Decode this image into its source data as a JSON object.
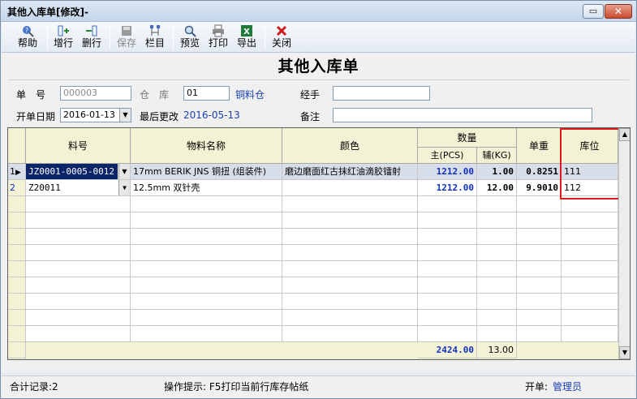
{
  "window": {
    "title": "其他入库单[修改]-",
    "restore_glyph": "▭",
    "close_glyph": "✕"
  },
  "toolbar": {
    "items": [
      {
        "label": "帮助",
        "icon": "help-icon"
      },
      {
        "label": "增行",
        "icon": "add-row-icon"
      },
      {
        "label": "删行",
        "icon": "delete-row-icon"
      },
      {
        "label": "保存",
        "icon": "save-icon"
      },
      {
        "label": "栏目",
        "icon": "columns-icon"
      },
      {
        "label": "预览",
        "icon": "preview-icon"
      },
      {
        "label": "打印",
        "icon": "print-icon"
      },
      {
        "label": "导出",
        "icon": "excel-export-icon"
      },
      {
        "label": "关闭",
        "icon": "close-icon"
      }
    ]
  },
  "form": {
    "doc_title": "其他入库单",
    "doc_no_label": "单　号",
    "doc_no_value": "000003",
    "warehouse_label": "仓　库",
    "warehouse_code": "01",
    "warehouse_name": "铜料仓",
    "handler_label": "经手",
    "handler_value": "",
    "date_label": "开单日期",
    "date_value": "2016-01-13",
    "modified_label": "最后更改",
    "modified_value": "2016-05-13",
    "remark_label": "备注",
    "remark_value": ""
  },
  "grid": {
    "headers": {
      "item_no": "料号",
      "item_name": "物料名称",
      "color": "颜色",
      "qty": "数量",
      "main_unit": "主(PCS)",
      "aux_unit": "辅(KG)",
      "unit_weight": "单重",
      "location": "库位"
    },
    "rows": [
      {
        "index": "1",
        "item_no": "JZ0001-0005-0012",
        "item_name": "17mm BERIK JNS 铜扭 (组装件)",
        "color": "磨边磨面红古抹红油滴胶镭射",
        "main_qty": "1212.00",
        "aux_qty": "1.00",
        "unit_weight": "0.8251",
        "location": "111"
      },
      {
        "index": "2",
        "item_no": "Z20011",
        "item_name": "12.5mm 双针壳",
        "color": "",
        "main_qty": "1212.00",
        "aux_qty": "12.00",
        "unit_weight": "9.9010",
        "location": "112"
      }
    ],
    "totals": {
      "main_qty": "2424.00",
      "aux_qty": "13.00"
    },
    "current_row_marker": "▶",
    "dropdown_glyph": "▼",
    "scroll_up": "▲",
    "scroll_down": "▼",
    "scroll_left": "◀",
    "scroll_right": "▶"
  },
  "status": {
    "record_count": "合计记录:2",
    "hint": "操作提示: F5打印当前行库存帖纸",
    "opener_label": "开单:",
    "opener_value": "管理员"
  },
  "colors": {
    "highlight_box": "#e01b1b",
    "value_blue": "#1230c0",
    "grid_bg": "#f4f2d4"
  }
}
